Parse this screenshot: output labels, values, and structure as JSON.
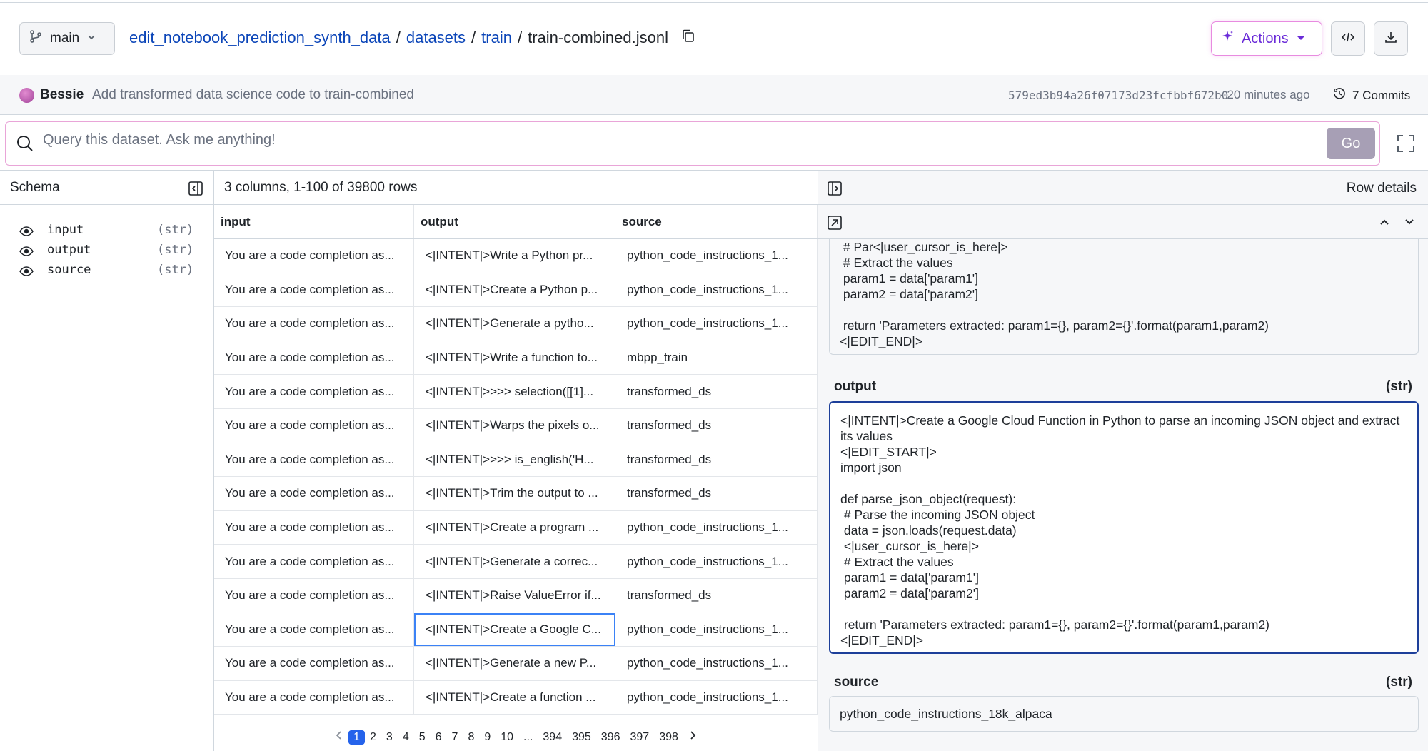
{
  "header": {
    "branch": "main",
    "breadcrumb": {
      "repo": "edit_notebook_prediction_synth_data",
      "dir1": "datasets",
      "dir2": "train",
      "file": "train-combined.jsonl",
      "sep": "/"
    },
    "actions_label": "Actions"
  },
  "commit": {
    "user": "Bessie",
    "message": "Add transformed data science code to train-combined",
    "hash": "579ed3b94a26f07173d23fcfbbf672b0",
    "time": "· 20 minutes ago",
    "commits_label": "7 Commits"
  },
  "query": {
    "placeholder": "Query this dataset. Ask me anything!",
    "go_label": "Go"
  },
  "schema": {
    "title": "Schema",
    "fields": [
      {
        "name": "input",
        "type": "(str)"
      },
      {
        "name": "output",
        "type": "(str)"
      },
      {
        "name": "source",
        "type": "(str)"
      }
    ]
  },
  "table": {
    "info": "3 columns, 1-100 of 39800 rows",
    "columns": [
      "input",
      "output",
      "source"
    ],
    "rows": [
      [
        "You are a code completion as...",
        "<|INTENT|>Write a Python pr...",
        "python_code_instructions_1..."
      ],
      [
        "You are a code completion as...",
        "<|INTENT|>Create a Python p...",
        "python_code_instructions_1..."
      ],
      [
        "You are a code completion as...",
        "<|INTENT|>Generate a pytho...",
        "python_code_instructions_1..."
      ],
      [
        "You are a code completion as...",
        "<|INTENT|>Write a function to...",
        "mbpp_train"
      ],
      [
        "You are a code completion as...",
        "<|INTENT|>>>> selection([[1]...",
        "transformed_ds"
      ],
      [
        "You are a code completion as...",
        "<|INTENT|>Warps the pixels o...",
        "transformed_ds"
      ],
      [
        "You are a code completion as...",
        "<|INTENT|>>>> is_english('H...",
        "transformed_ds"
      ],
      [
        "You are a code completion as...",
        "<|INTENT|>Trim the output to ...",
        "transformed_ds"
      ],
      [
        "You are a code completion as...",
        "<|INTENT|>Create a program ...",
        "python_code_instructions_1..."
      ],
      [
        "You are a code completion as...",
        "<|INTENT|>Generate a correc...",
        "python_code_instructions_1..."
      ],
      [
        "You are a code completion as...",
        "<|INTENT|>Raise ValueError if...",
        "transformed_ds"
      ],
      [
        "You are a code completion as...",
        "<|INTENT|>Create a Google C...",
        "python_code_instructions_1..."
      ],
      [
        "You are a code completion as...",
        "<|INTENT|>Generate a new P...",
        "python_code_instructions_1..."
      ],
      [
        "You are a code completion as...",
        "<|INTENT|>Create a function ...",
        "python_code_instructions_1..."
      ]
    ],
    "pager": [
      "1",
      "2",
      "3",
      "4",
      "5",
      "6",
      "7",
      "8",
      "9",
      "10",
      "...",
      "394",
      "395",
      "396",
      "397",
      "398"
    ]
  },
  "details": {
    "title": "Row details",
    "input_text": " # Par<|user_cursor_is_here|>\n # Extract the values\n param1 = data['param1']\n param2 = data['param2']\n\n return 'Parameters extracted: param1={}, param2={}'.format(param1,param2)\n<|EDIT_END|>",
    "output_label": "output",
    "output_type": "(str)",
    "output_text": "<|INTENT|>Create a Google Cloud Function in Python to parse an incoming JSON object and extract its values\n<|EDIT_START|>\nimport json\n\ndef parse_json_object(request):\n # Parse the incoming JSON object\n data = json.loads(request.data)\n <|user_cursor_is_here|>\n # Extract the values\n param1 = data['param1']\n param2 = data['param2']\n\n return 'Parameters extracted: param1={}, param2={}'.format(param1,param2)\n<|EDIT_END|>",
    "source_label": "source",
    "source_type": "(str)",
    "source_text": "python_code_instructions_18k_alpaca"
  }
}
